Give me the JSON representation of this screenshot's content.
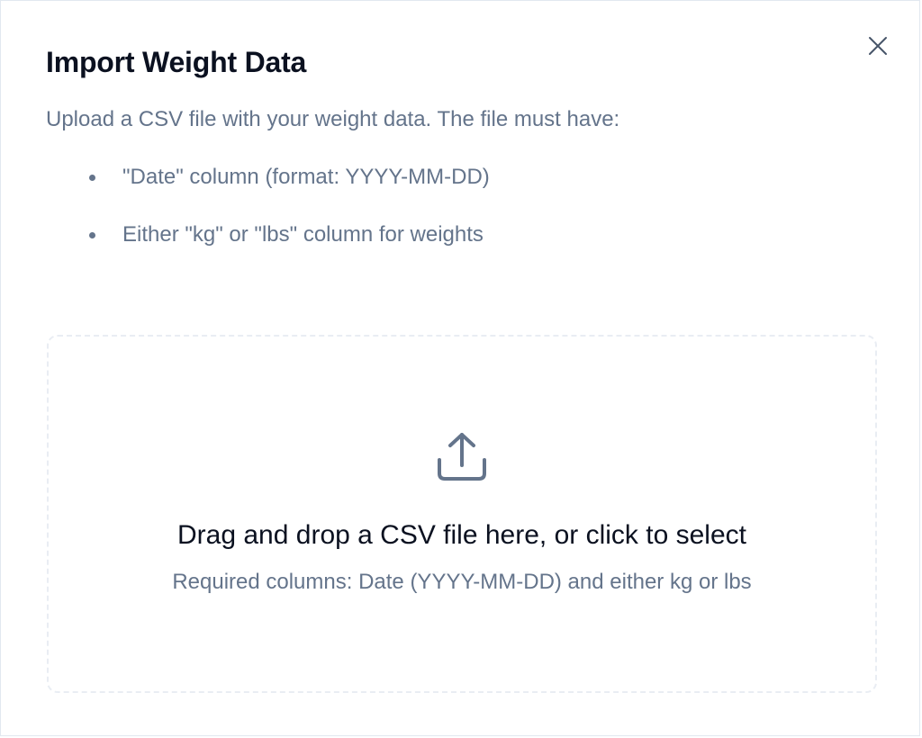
{
  "dialog": {
    "title": "Import Weight Data",
    "close_icon": "close-icon",
    "description": "Upload a CSV file with your weight data. The file must have:",
    "requirements": [
      "\"Date\" column (format: YYYY-MM-DD)",
      "Either \"kg\" or \"lbs\" column for weights"
    ]
  },
  "dropzone": {
    "icon": "upload-icon",
    "primary_text": "Drag and drop a CSV file here, or click to select",
    "hint_text": "Required columns: Date (YYYY-MM-DD) and either kg or lbs"
  },
  "colors": {
    "title": "#0b1120",
    "muted_text": "#64748b",
    "border": "#e2e8f0",
    "dropzone_border": "#e9edf3"
  }
}
